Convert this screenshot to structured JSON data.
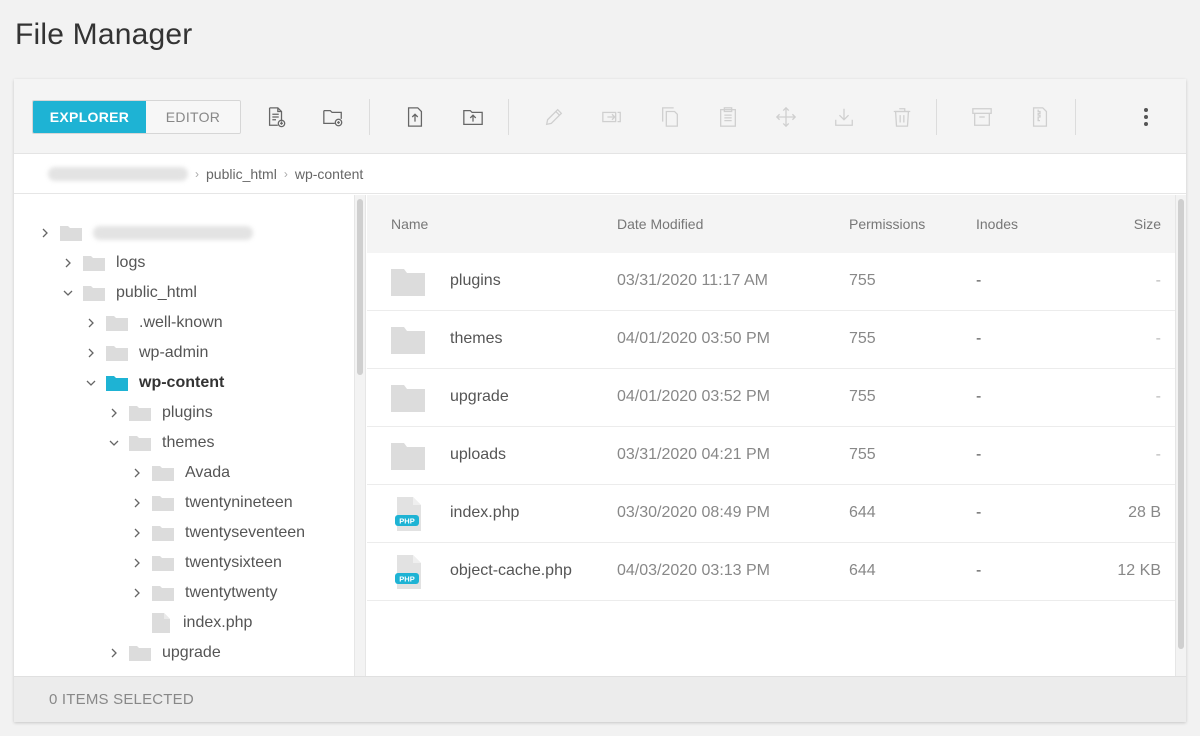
{
  "page": {
    "title": "File Manager"
  },
  "toolbar": {
    "explorer_label": "EXPLORER",
    "editor_label": "EDITOR",
    "icons": [
      "new-file-icon",
      "new-folder-icon",
      "upload-file-icon",
      "upload-folder-icon",
      "rename-icon",
      "copy-to-icon",
      "duplicate-icon",
      "paste-icon",
      "move-icon",
      "download-icon",
      "delete-icon",
      "archive-icon",
      "extract-icon",
      "more-options-icon"
    ]
  },
  "breadcrumb": {
    "items": [
      "public_html",
      "wp-content"
    ]
  },
  "tree": {
    "items": [
      {
        "label": "logs",
        "type": "folder",
        "expanded": false
      },
      {
        "label": "public_html",
        "type": "folder",
        "expanded": true
      },
      {
        "label": ".well-known",
        "type": "folder",
        "expanded": false
      },
      {
        "label": "wp-admin",
        "type": "folder",
        "expanded": false
      },
      {
        "label": "wp-content",
        "type": "folder",
        "expanded": true,
        "selected": true
      },
      {
        "label": "plugins",
        "type": "folder",
        "expanded": false
      },
      {
        "label": "themes",
        "type": "folder",
        "expanded": true
      },
      {
        "label": "Avada",
        "type": "folder",
        "expanded": false
      },
      {
        "label": "twentynineteen",
        "type": "folder",
        "expanded": false
      },
      {
        "label": "twentyseventeen",
        "type": "folder",
        "expanded": false
      },
      {
        "label": "twentysixteen",
        "type": "folder",
        "expanded": false
      },
      {
        "label": "twentytwenty",
        "type": "folder",
        "expanded": false
      },
      {
        "label": "index.php",
        "type": "file"
      },
      {
        "label": "upgrade",
        "type": "folder",
        "expanded": false
      }
    ]
  },
  "table": {
    "headers": {
      "name": "Name",
      "date": "Date Modified",
      "perms": "Permissions",
      "inodes": "Inodes",
      "size": "Size"
    },
    "rows": [
      {
        "name": "plugins",
        "type": "folder",
        "date": "03/31/2020 11:17 AM",
        "perms": "755",
        "inodes": "-",
        "size": "-"
      },
      {
        "name": "themes",
        "type": "folder",
        "date": "04/01/2020 03:50 PM",
        "perms": "755",
        "inodes": "-",
        "size": "-"
      },
      {
        "name": "upgrade",
        "type": "folder",
        "date": "04/01/2020 03:52 PM",
        "perms": "755",
        "inodes": "-",
        "size": "-"
      },
      {
        "name": "uploads",
        "type": "folder",
        "date": "03/31/2020 04:21 PM",
        "perms": "755",
        "inodes": "-",
        "size": "-"
      },
      {
        "name": "index.php",
        "type": "php",
        "date": "03/30/2020 08:49 PM",
        "perms": "644",
        "inodes": "-",
        "size": "28 B"
      },
      {
        "name": "object-cache.php",
        "type": "php",
        "date": "04/03/2020 03:13 PM",
        "perms": "644",
        "inodes": "-",
        "size": "12 KB"
      }
    ]
  },
  "php_badge": "PHP",
  "footer": {
    "status": "0 ITEMS SELECTED"
  },
  "colors": {
    "accent": "#1eb3d4",
    "folder": "#dcdcdc",
    "selected_folder": "#1eb3d4"
  }
}
